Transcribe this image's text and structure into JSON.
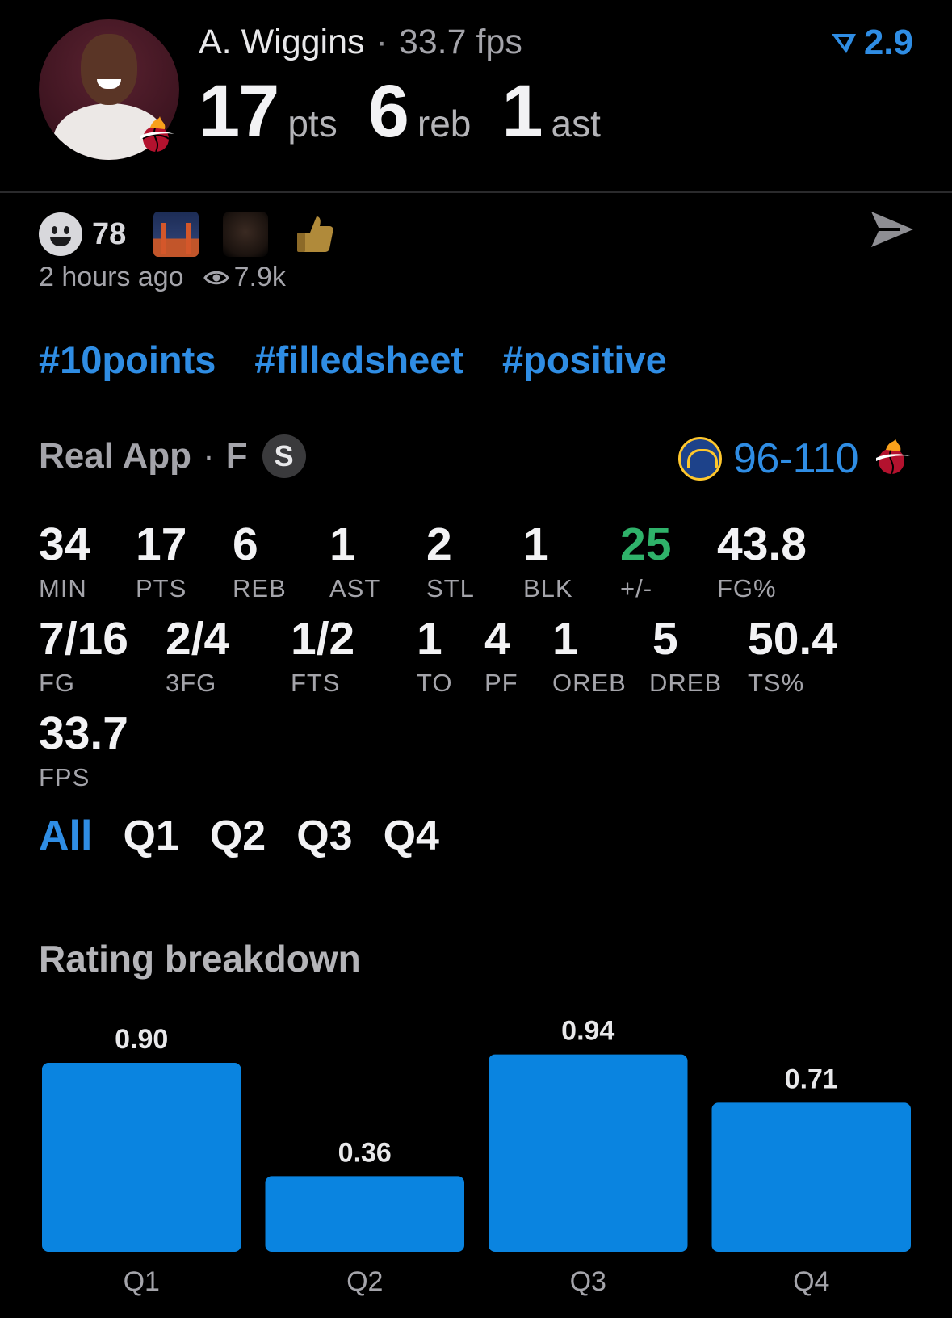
{
  "header": {
    "player_name": "A. Wiggins",
    "separator": "·",
    "fps_label": "33.7 fps",
    "rating": "2.9",
    "points": "17",
    "points_label": "pts",
    "rebounds": "6",
    "rebounds_label": "reb",
    "assists": "1",
    "assists_label": "ast",
    "team_color": "#98002e"
  },
  "reactions": {
    "count": "78",
    "emojis": [
      "bridge-at-night-icon",
      "player-face-icon",
      "thumbs-up-icon"
    ],
    "posted": "2 hours ago",
    "views": "7.9k"
  },
  "tags": [
    "#10points",
    "#filledsheet",
    "#positive"
  ],
  "game": {
    "source": "Real App",
    "status": "F",
    "badge": "S",
    "score": "96-110",
    "away_logo": "warriors-logo-icon",
    "home_logo": "heat-logo-icon"
  },
  "stats_row1": [
    {
      "value": "34",
      "label": "MIN"
    },
    {
      "value": "17",
      "label": "PTS"
    },
    {
      "value": "6",
      "label": "REB"
    },
    {
      "value": "1",
      "label": "AST"
    },
    {
      "value": "2",
      "label": "STL"
    },
    {
      "value": "1",
      "label": "BLK"
    },
    {
      "value": "25",
      "label": "+/-"
    },
    {
      "value": "43.8",
      "label": "FG%"
    }
  ],
  "stats_row2": [
    {
      "value": "7/16",
      "label": "FG"
    },
    {
      "value": "2/4",
      "label": "3FG"
    },
    {
      "value": "1/2",
      "label": "FTS"
    },
    {
      "value": "1",
      "label": "TO"
    },
    {
      "value": "4",
      "label": "PF"
    },
    {
      "value": "1",
      "label": "OREB"
    },
    {
      "value": "5",
      "label": "DREB"
    },
    {
      "value": "50.4",
      "label": "TS%"
    }
  ],
  "stats_row3": [
    {
      "value": "33.7",
      "label": "FPS"
    }
  ],
  "quarter_tabs": [
    "All",
    "Q1",
    "Q2",
    "Q3",
    "Q4"
  ],
  "active_tab": "All",
  "colors": {
    "accent": "#2f8de4",
    "positive": "#2fb26a",
    "bar": "#0a84e0"
  },
  "chart_title": "Rating breakdown",
  "chart_data": {
    "type": "bar",
    "title": "Rating breakdown",
    "categories": [
      "Q1",
      "Q2",
      "Q3",
      "Q4"
    ],
    "values": [
      0.9,
      0.36,
      0.94,
      0.71
    ],
    "value_labels": [
      "0.90",
      "0.36",
      "0.94",
      "0.71"
    ],
    "ylim": [
      0,
      1
    ],
    "grid": false
  }
}
